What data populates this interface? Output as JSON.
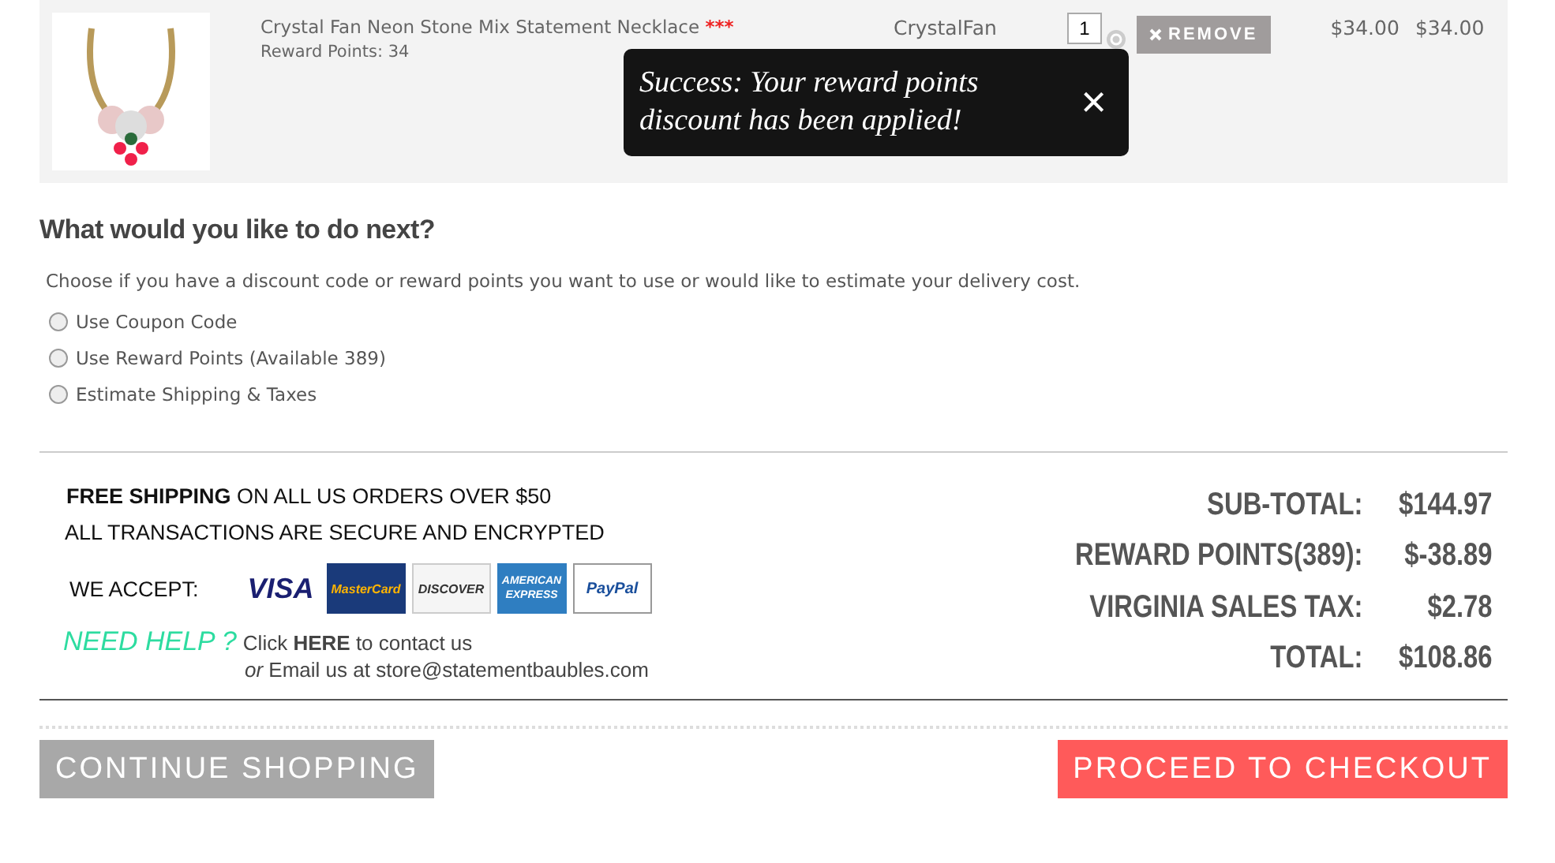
{
  "cart_item": {
    "name": "Crystal Fan Neon Stone Mix Statement Necklace",
    "required_mark": "***",
    "reward_points": "Reward Points: 34",
    "model": "CrystalFan",
    "quantity": "1",
    "remove_button": "REMOVE",
    "unit_price": "$34.00",
    "total": "$34.00"
  },
  "toast": {
    "message": "Success: Your reward points discount has been applied!",
    "close": "×"
  },
  "next_step": {
    "heading": "What would you like to do next?",
    "description": "Choose if you have a discount code or reward points you want to use or would like to estimate your delivery cost.",
    "options": [
      {
        "label": "Use Coupon Code",
        "selected": false
      },
      {
        "label": "Use Reward Points (Available 389)",
        "selected": false
      },
      {
        "label": "Estimate Shipping & Taxes",
        "selected": false
      }
    ]
  },
  "info": {
    "shipping": "**FREE SHIPPING** ON ALL US ORDERS OVER $50",
    "security": "ALL TRANSACTIONS ARE SECURE AND ENCRYPTED",
    "accept_label": "WE ACCEPT:",
    "cards": [
      {
        "kind": "visa",
        "label": "VISA"
      },
      {
        "kind": "mastercard",
        "label": "MasterCard"
      },
      {
        "kind": "discover",
        "label": "DISCOVER"
      },
      {
        "kind": "amex",
        "label": "AMERICAN EXPRESS"
      },
      {
        "kind": "paypal",
        "label": "PayPal"
      }
    ],
    "help_label": "NEED HELP ?",
    "help_text": "Click **HERE** to contact us",
    "email_text": "*or* Email us at store@statementbaubles.com"
  },
  "totals": [
    {
      "label": "SUB-TOTAL:",
      "value": "$144.97"
    },
    {
      "label": "REWARD POINTS(389):",
      "value": "$-38.89"
    },
    {
      "label": "VIRGINIA SALES TAX:",
      "value": "$2.78"
    },
    {
      "label": "TOTAL:",
      "value": "$108.86"
    }
  ],
  "buttons": {
    "continue": "CONTINUE SHOPPING",
    "checkout": "PROCEED TO CHECKOUT"
  }
}
